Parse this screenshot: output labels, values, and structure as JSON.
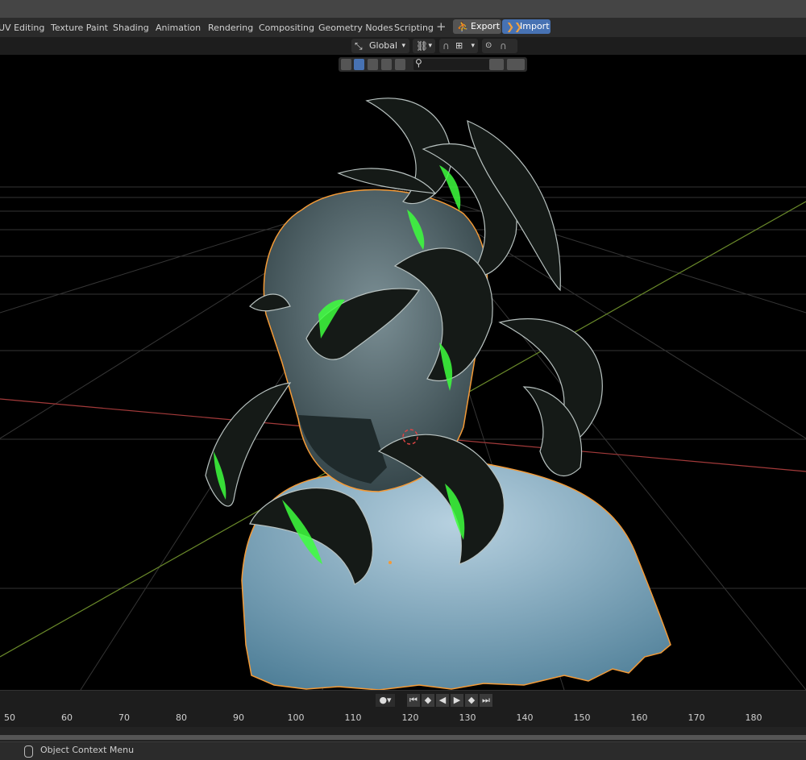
{
  "workspace_tabs": [
    "UV Editing",
    "Texture Paint",
    "Shading",
    "Animation",
    "Rendering",
    "Compositing",
    "Geometry Nodes",
    "Scripting"
  ],
  "add_workspace": "+",
  "export_label": "Export",
  "import_label": "Import",
  "colors": {
    "import_accent": "#4772b3",
    "selection_outline": "#f39a37",
    "x_axis": "#a33a3a",
    "y_axis": "#6a8a2a",
    "highlight_green": "#3dff3d"
  },
  "header": {
    "orientation": "Global",
    "snap": "",
    "proportional": ""
  },
  "timeline": {
    "frame_numbers": [
      "50",
      "60",
      "70",
      "80",
      "90",
      "100",
      "110",
      "120",
      "130",
      "140",
      "150",
      "160",
      "170",
      "180"
    ]
  },
  "status": {
    "context_menu": "Object Context Menu"
  }
}
